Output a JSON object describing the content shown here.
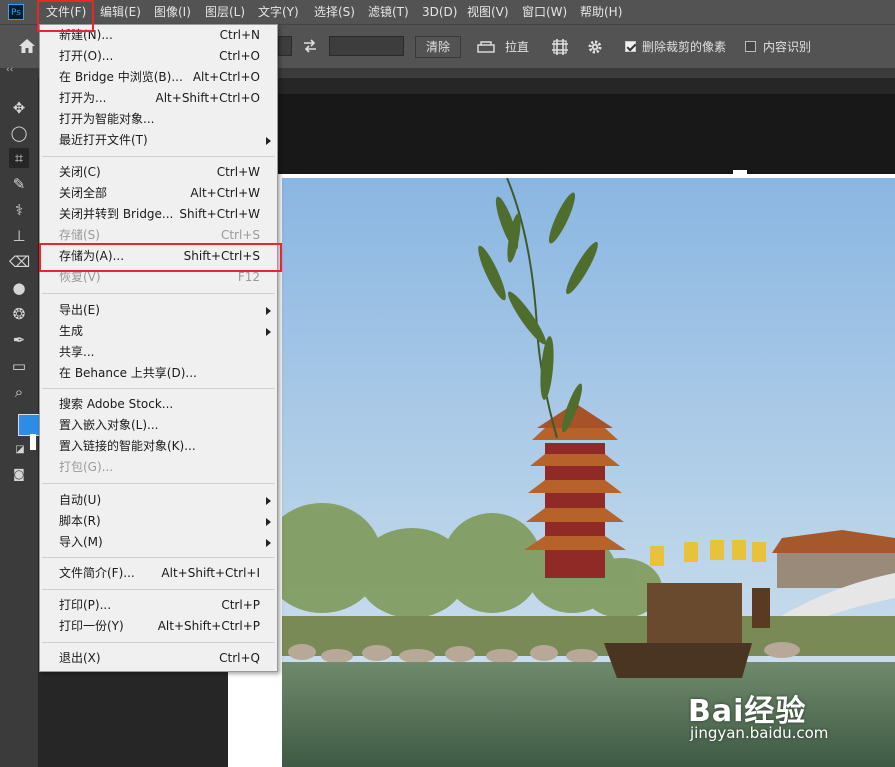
{
  "app": {
    "logo_text": "Ps"
  },
  "menubar": {
    "items": [
      "文件(F)",
      "编辑(E)",
      "图像(I)",
      "图层(L)",
      "文字(Y)",
      "选择(S)",
      "滤镜(T)",
      "3D(D)",
      "视图(V)",
      "窗口(W)",
      "帮助(H)"
    ]
  },
  "options": {
    "clear_label": "清除",
    "straighten_label": "拉直",
    "delete_cropped_label": "删除裁剪的像素",
    "delete_cropped_checked": true,
    "content_aware_label": "内容识别",
    "content_aware_checked": false
  },
  "colors": {
    "foreground": "#2d8de6",
    "background": "#ffffff",
    "highlight": "#e8262c"
  },
  "file_menu": {
    "items": [
      {
        "label": "新建(N)...",
        "shortcut": "Ctrl+N"
      },
      {
        "label": "打开(O)...",
        "shortcut": "Ctrl+O"
      },
      {
        "label": "在 Bridge 中浏览(B)...",
        "shortcut": "Alt+Ctrl+O"
      },
      {
        "label": "打开为...",
        "shortcut": "Alt+Shift+Ctrl+O"
      },
      {
        "label": "打开为智能对象...",
        "shortcut": ""
      },
      {
        "label": "最近打开文件(T)",
        "shortcut": "",
        "submenu": true
      },
      {
        "label": "关闭(C)",
        "shortcut": "Ctrl+W"
      },
      {
        "label": "关闭全部",
        "shortcut": "Alt+Ctrl+W"
      },
      {
        "label": "关闭并转到 Bridge...",
        "shortcut": "Shift+Ctrl+W"
      },
      {
        "label": "存储(S)",
        "shortcut": "Ctrl+S",
        "disabled": true
      },
      {
        "label": "存储为(A)...",
        "shortcut": "Shift+Ctrl+S",
        "highlighted": true
      },
      {
        "label": "恢复(V)",
        "shortcut": "F12",
        "disabled": true
      },
      {
        "label": "导出(E)",
        "shortcut": "",
        "submenu": true
      },
      {
        "label": "生成",
        "shortcut": "",
        "submenu": true
      },
      {
        "label": "共享...",
        "shortcut": ""
      },
      {
        "label": "在 Behance 上共享(D)...",
        "shortcut": ""
      },
      {
        "label": "搜索 Adobe Stock...",
        "shortcut": ""
      },
      {
        "label": "置入嵌入对象(L)...",
        "shortcut": ""
      },
      {
        "label": "置入链接的智能对象(K)...",
        "shortcut": ""
      },
      {
        "label": "打包(G)...",
        "shortcut": "",
        "disabled": true
      },
      {
        "label": "自动(U)",
        "shortcut": "",
        "submenu": true
      },
      {
        "label": "脚本(R)",
        "shortcut": "",
        "submenu": true
      },
      {
        "label": "导入(M)",
        "shortcut": "",
        "submenu": true
      },
      {
        "label": "文件简介(F)...",
        "shortcut": "Alt+Shift+Ctrl+I"
      },
      {
        "label": "打印(P)...",
        "shortcut": "Ctrl+P"
      },
      {
        "label": "打印一份(Y)",
        "shortcut": "Alt+Shift+Ctrl+P"
      },
      {
        "label": "退出(X)",
        "shortcut": "Ctrl+Q"
      }
    ]
  },
  "watermark": {
    "brand": "Bai经验",
    "url": "jingyan.baidu.com"
  }
}
